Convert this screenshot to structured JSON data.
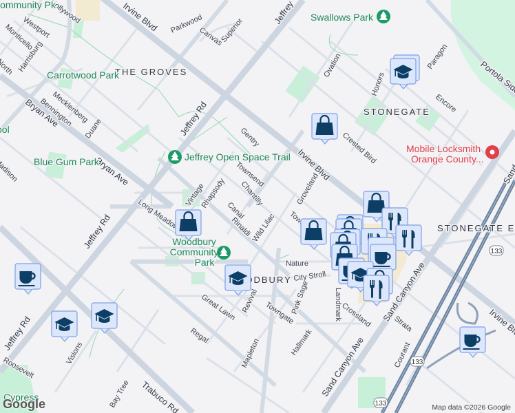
{
  "colors": {
    "background": "#f3f2f5",
    "park": "#c8efd8",
    "marker_fill": "#dce7fb",
    "marker_icon": "#0d3f66",
    "business": "#e0404a",
    "freeway": "#6b84a0"
  },
  "roads": {
    "irvine_blvd": "Irvine Blvd",
    "jeffrey_rd": "Jeffrey Rd",
    "bryan_ave": "Bryan Ave",
    "trabuco_rd": "Trabuco Rd",
    "sand_canyon_ave": "Sand Canyon Ave",
    "portola": "Portola Side",
    "jeffrey_top": "Jeffrey",
    "sand_edge": "Sand"
  },
  "streets": [
    "Parkwood",
    "Canvas",
    "Superior",
    "Westport",
    "Monticello",
    "Harrisburg",
    "Mecklenberg",
    "Bennington",
    "Duane",
    "Gentry",
    "Townsend",
    "Chantilly",
    "Canal",
    "Rhapsody",
    "Vintage",
    "Long Meadow",
    "Rinaldi",
    "Wild Lilac",
    "Groveland",
    "Crested Bird",
    "Ovation",
    "Honors",
    "Paragon",
    "Encore",
    "Nature",
    "City Stroll",
    "Pink Sage",
    "Towngate",
    "Revival",
    "Great Lawn",
    "Regal",
    "Mapleton",
    "Hallmark",
    "Crossland",
    "Strata",
    "Courant",
    "Visions",
    "Roosevelt",
    "Bay Tree",
    "Landmark",
    "Towne",
    "Madison",
    "Hollywood",
    "North"
  ],
  "places": {
    "swallows": "Swallows Park",
    "groves": "THE GROVES",
    "stonegate": "STONEGATE",
    "stonegate_east": "STONEGATE EAST",
    "woodbury": "WOODBURY",
    "carrotwood": "Carrotwood Park",
    "bluegum": "Blue Gum Park",
    "jeffrey_trail": "Jeffrey Open Space Trail",
    "woodbury_park": "Woodbury Community Park",
    "community_pk": "Community Pk",
    "cypress": "Cypress",
    "school_fragment": "ool"
  },
  "business": {
    "name_line1": "Mobile Locksmith",
    "name_line2": "Orange County..."
  },
  "highway": "133",
  "attribution": "Map data ©2026 Google",
  "logo": "Google"
}
